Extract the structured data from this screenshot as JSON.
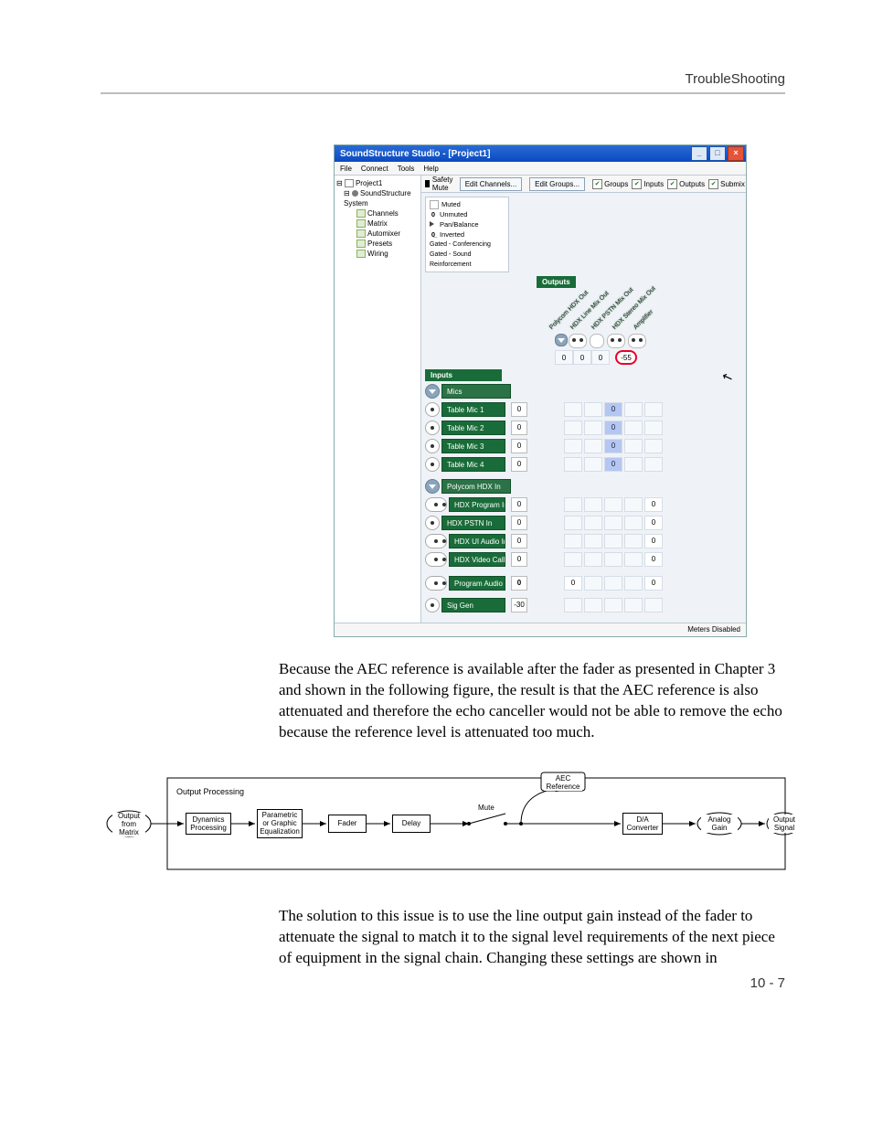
{
  "header": {
    "title": "TroubleShooting"
  },
  "footer": {
    "pageno": "10 - 7"
  },
  "screenshot": {
    "window_title": "SoundStructure Studio - [Project1]",
    "menus": [
      "File",
      "Connect",
      "Tools",
      "Help"
    ],
    "tree": {
      "root": "Project1",
      "system": "SoundStructure System",
      "items": [
        "Channels",
        "Matrix",
        "Automixer",
        "Presets",
        "Wiring"
      ]
    },
    "toolbar": {
      "safety_mute": "Safety Mute",
      "btn_channels": "Edit Channels...",
      "btn_groups": "Edit Groups...",
      "chk_groups": "Groups",
      "chk_inputs": "Inputs",
      "chk_outputs": "Outputs",
      "chk_submix": "Submix"
    },
    "legend": {
      "muted": "Muted",
      "unmuted": "Unmuted",
      "pan": "Pan/Balance",
      "inverted": "Inverted",
      "gated_conf": "Gated - Conferencing",
      "gated_sr": "Gated - Sound Reinforcement"
    },
    "outputs": {
      "label": "Outputs",
      "cols": [
        "Polycom HDX Out",
        "HDX Line Mix Out",
        "HDX PSTN Mix Out",
        "HDX Stereo Mix Out",
        "Amplifier"
      ],
      "values": [
        "0",
        "0",
        "0",
        "-55"
      ]
    },
    "inputs_label": "Inputs",
    "groups": [
      {
        "name": "Mics",
        "channels": [
          {
            "name": "Table Mic 1",
            "val": "0",
            "cross_col": 2,
            "cross_val": "0"
          },
          {
            "name": "Table Mic 2",
            "val": "0",
            "cross_col": 2,
            "cross_val": "0"
          },
          {
            "name": "Table Mic 3",
            "val": "0",
            "cross_col": 2,
            "cross_val": "0"
          },
          {
            "name": "Table Mic 4",
            "val": "0",
            "cross_col": 2,
            "cross_val": "0"
          }
        ]
      },
      {
        "name": "Polycom HDX In",
        "channels": [
          {
            "name": "HDX Program In",
            "val": "0",
            "stereo": true,
            "cross_col": 4,
            "cross_val": "0"
          },
          {
            "name": "HDX PSTN In",
            "val": "0",
            "cross_col": 4,
            "cross_val": "0"
          },
          {
            "name": "HDX UI Audio In",
            "val": "0",
            "stereo": true,
            "cross_col": 4,
            "cross_val": "0"
          },
          {
            "name": "HDX Video Call In",
            "val": "0",
            "stereo": true,
            "cross_col": 4,
            "cross_val": "0"
          }
        ]
      }
    ],
    "loose_inputs": [
      {
        "name": "Program Audio",
        "val": "0",
        "stereo": true,
        "crossA_col": 0,
        "crossA_val": "0",
        "crossB_col": 4,
        "crossB_val": "0"
      },
      {
        "name": "Sig Gen",
        "val": "-30"
      }
    ],
    "status_bar": "Meters Disabled"
  },
  "para1": "Because the AEC reference is available after the fader as presented in Chapter 3 and shown in the following figure, the result is that the AEC reference is also attenuated and therefore the echo canceller would not be able to remove the echo because the reference level is attenuated too much.",
  "diagram": {
    "title": "Output Processing",
    "nodes": {
      "in": "Output from\nMatrix",
      "dyn": "Dynamics\nProcessing",
      "eq": "Parametric\nor Graphic\nEqualization",
      "fader": "Fader",
      "delay": "Delay",
      "mute": "Mute",
      "aec": "AEC\nReference",
      "da": "D/A\nConverter",
      "gain": "Analog\nGain",
      "out": "Output\nSignal"
    }
  },
  "para2": "The solution to this issue is to use the line output gain instead of the fader to attenuate the signal to match it to the signal level requirements of the next piece of equipment in the signal chain. Changing these settings are shown in"
}
